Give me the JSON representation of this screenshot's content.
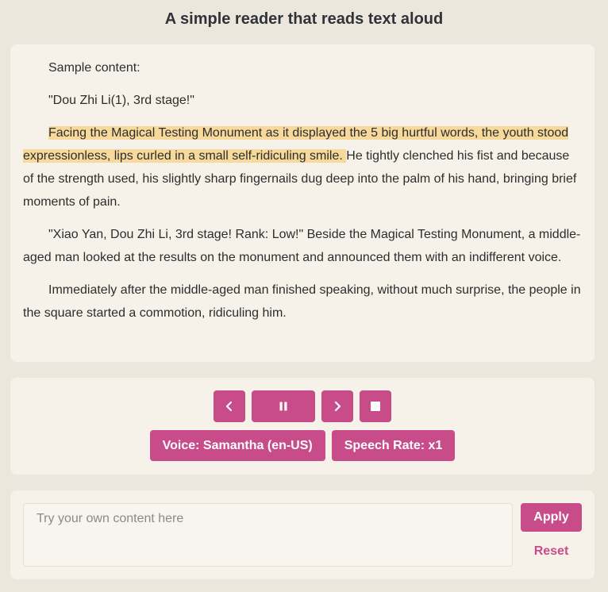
{
  "header": {
    "title": "A simple reader that reads text aloud"
  },
  "reader": {
    "paragraphs": [
      {
        "text": "Sample content:"
      },
      {
        "text": "\"Dou Zhi Li(1), 3rd stage!\""
      },
      {
        "highlighted": "Facing the Magical Testing Monument as it displayed the 5 big hurtful words, the youth stood expressionless, lips curled in a small self-ridiculing smile. ",
        "rest": "He tightly clenched his fist and because of the strength used, his slightly sharp fingernails dug deep into the palm of his hand, bringing brief moments of pain."
      },
      {
        "text": "\"Xiao Yan, Dou Zhi Li, 3rd stage! Rank: Low!\" Beside the Magical Testing Monument, a middle-aged man looked at the results on the monument and announced them with an indifferent voice."
      },
      {
        "text": "Immediately after the middle-aged man finished speaking, without much surprise, the people in the square started a commotion, ridiculing him."
      }
    ],
    "highlight_color": "#f7d99b"
  },
  "controls": {
    "buttons": [
      {
        "name": "previous-button",
        "icon": "chevron-left-icon"
      },
      {
        "name": "pause-button",
        "icon": "pause-icon"
      },
      {
        "name": "next-button",
        "icon": "chevron-right-icon"
      },
      {
        "name": "stop-button",
        "icon": "stop-icon"
      }
    ],
    "voice_label": "Voice: Samantha (en-US)",
    "rate_label": "Speech Rate: x1",
    "accent_color": "#c84b8a"
  },
  "custom_input": {
    "placeholder": "Try your own content here",
    "value": "",
    "apply_label": "Apply",
    "reset_label": "Reset"
  }
}
